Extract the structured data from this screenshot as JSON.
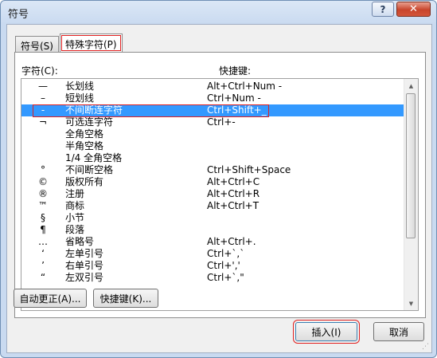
{
  "window": {
    "title": "符号",
    "help": "?",
    "close": "✕"
  },
  "tabs": [
    {
      "label": "符号(S)"
    },
    {
      "label": "特殊字符(P)"
    }
  ],
  "columns": {
    "character": "字符(C):",
    "shortcut": "快捷键:"
  },
  "rows": [
    {
      "symbol": "—",
      "name": "长划线",
      "shortcut": "Alt+Ctrl+Num -"
    },
    {
      "symbol": "–",
      "name": "短划线",
      "shortcut": "Ctrl+Num -"
    },
    {
      "symbol": "-",
      "name": "不间断连字符",
      "shortcut": "Ctrl+Shift+_"
    },
    {
      "symbol": "¬",
      "name": "可选连字符",
      "shortcut": "Ctrl+-"
    },
    {
      "symbol": "",
      "name": "全角空格",
      "shortcut": ""
    },
    {
      "symbol": "",
      "name": "半角空格",
      "shortcut": ""
    },
    {
      "symbol": "",
      "name": "1/4 全角空格",
      "shortcut": ""
    },
    {
      "symbol": "°",
      "name": "不间断空格",
      "shortcut": "Ctrl+Shift+Space"
    },
    {
      "symbol": "©",
      "name": "版权所有",
      "shortcut": "Alt+Ctrl+C"
    },
    {
      "symbol": "®",
      "name": "注册",
      "shortcut": "Alt+Ctrl+R"
    },
    {
      "symbol": "™",
      "name": "商标",
      "shortcut": "Alt+Ctrl+T"
    },
    {
      "symbol": "§",
      "name": "小节",
      "shortcut": ""
    },
    {
      "symbol": "¶",
      "name": "段落",
      "shortcut": ""
    },
    {
      "symbol": "…",
      "name": "省略号",
      "shortcut": "Alt+Ctrl+."
    },
    {
      "symbol": "‘",
      "name": "左单引号",
      "shortcut": "Ctrl+`,`"
    },
    {
      "symbol": "’",
      "name": "右单引号",
      "shortcut": "Ctrl+','"
    },
    {
      "symbol": "“",
      "name": "左双引号",
      "shortcut": "Ctrl+`,\""
    }
  ],
  "buttons": {
    "autocorrect": "自动更正(A)...",
    "shortcut_key": "快捷键(K)...",
    "insert": "插入(I)",
    "cancel": "取消"
  },
  "scroll": {
    "up": "▲",
    "down": "▼"
  }
}
